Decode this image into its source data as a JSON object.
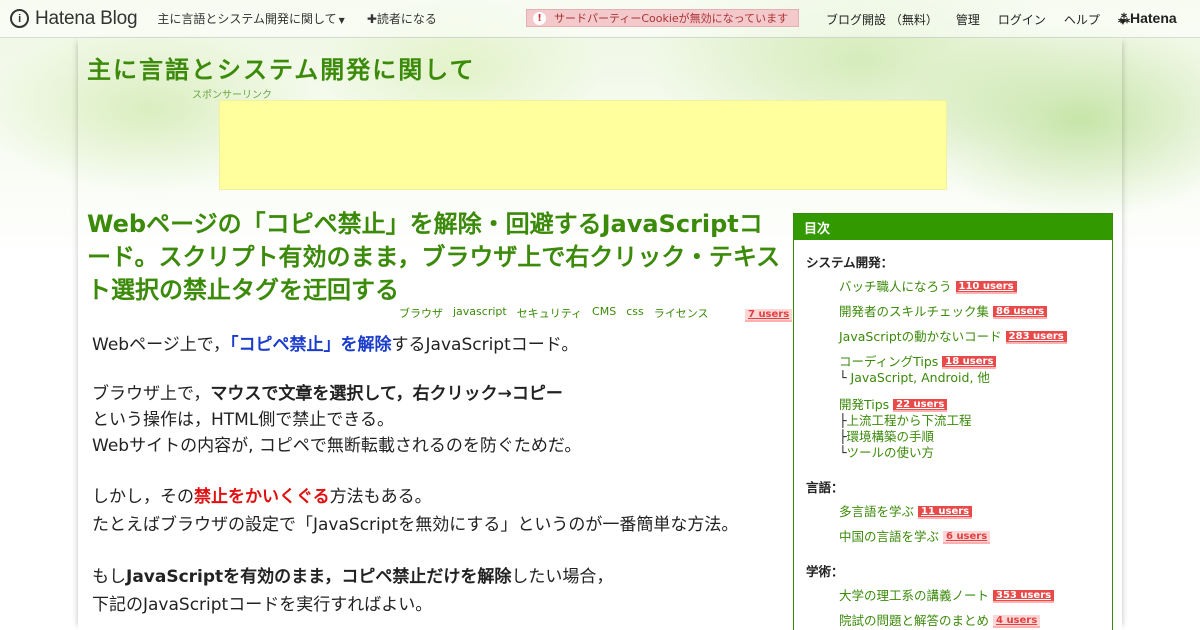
{
  "topbar": {
    "logo": "Hatena Blog",
    "logo_mark": "i",
    "blog_menu": "主に言語とシステム開発に関して",
    "subscribe": "読者になる",
    "cookie_warning": "サードパーティーCookieが無効になっています",
    "cookie_icon": "!",
    "open_blog": "ブログ開設 （無料）",
    "manage": "管理",
    "login": "ログイン",
    "help": "ヘルプ",
    "hatena": "Hatena"
  },
  "header": {
    "blog_title": "主に言語とシステム開発に関して",
    "sponsor_label": "スポンサーリンク"
  },
  "article": {
    "title": "Webページの「コピペ禁止」を解除・回避するJavaScriptコード。スクリプト有効のまま，ブラウザ上で右クリック・テキスト選択の禁止タグを迂回する",
    "tags": [
      "ブラウザ",
      "javascript",
      "セキュリティ",
      "CMS",
      "css",
      "ライセンス"
    ],
    "users": "7 users",
    "p1_a": "Webページ上で，",
    "p1_b": "「コピペ禁止」を解除",
    "p1_c": "するJavaScriptコード。",
    "p2_a": "ブラウザ上で，",
    "p2_b": "マウスで文章を選択して，右クリック→コピー",
    "p2_c": "という操作は，HTML側で禁止できる。",
    "p2_d": "Webサイトの内容が, コピペで無断転載されるのを防ぐためだ。",
    "p3_a": "しかし，その",
    "p3_b": "禁止をかいくぐる",
    "p3_c": "方法もある。",
    "p3_d": "たとえばブラウザの設定で「JavaScriptを無効にする」というのが一番簡単な方法。",
    "p4_a": "もし",
    "p4_b": "JavaScriptを有効のまま，コピペ禁止だけを解除",
    "p4_c": "したい場合，",
    "p4_d": "下記のJavaScriptコードを実行すればよい。"
  },
  "sidebar": {
    "heading": "目次",
    "cat1": "システム開発：",
    "i1": "バッチ職人になろう",
    "u1": "110 users",
    "i2": "開発者のスキルチェック集",
    "u2": "86 users",
    "i3": "JavaScriptの動かないコード",
    "u3": "283 users",
    "i4": "コーディングTips",
    "u4": "18 users",
    "i4_sub_mark": "└",
    "i4_sub": "JavaScript, Android, 他",
    "i5": "開発Tips",
    "u5": "22 users",
    "i5_s1_mark": "├",
    "i5_s1": "上流工程から下流工程",
    "i5_s2_mark": "├",
    "i5_s2": "環境構築の手順",
    "i5_s3_mark": "└",
    "i5_s3": "ツールの使い方",
    "cat2": "言語：",
    "i6": "多言語を学ぶ",
    "u6": "11 users",
    "i7": "中国の言語を学ぶ",
    "u7": "6 users",
    "cat3": "学術：",
    "i8": "大学の理工系の講義ノート",
    "u8": "353 users",
    "i9": "院試の問題と解答のまとめ",
    "u9": "4 users"
  }
}
